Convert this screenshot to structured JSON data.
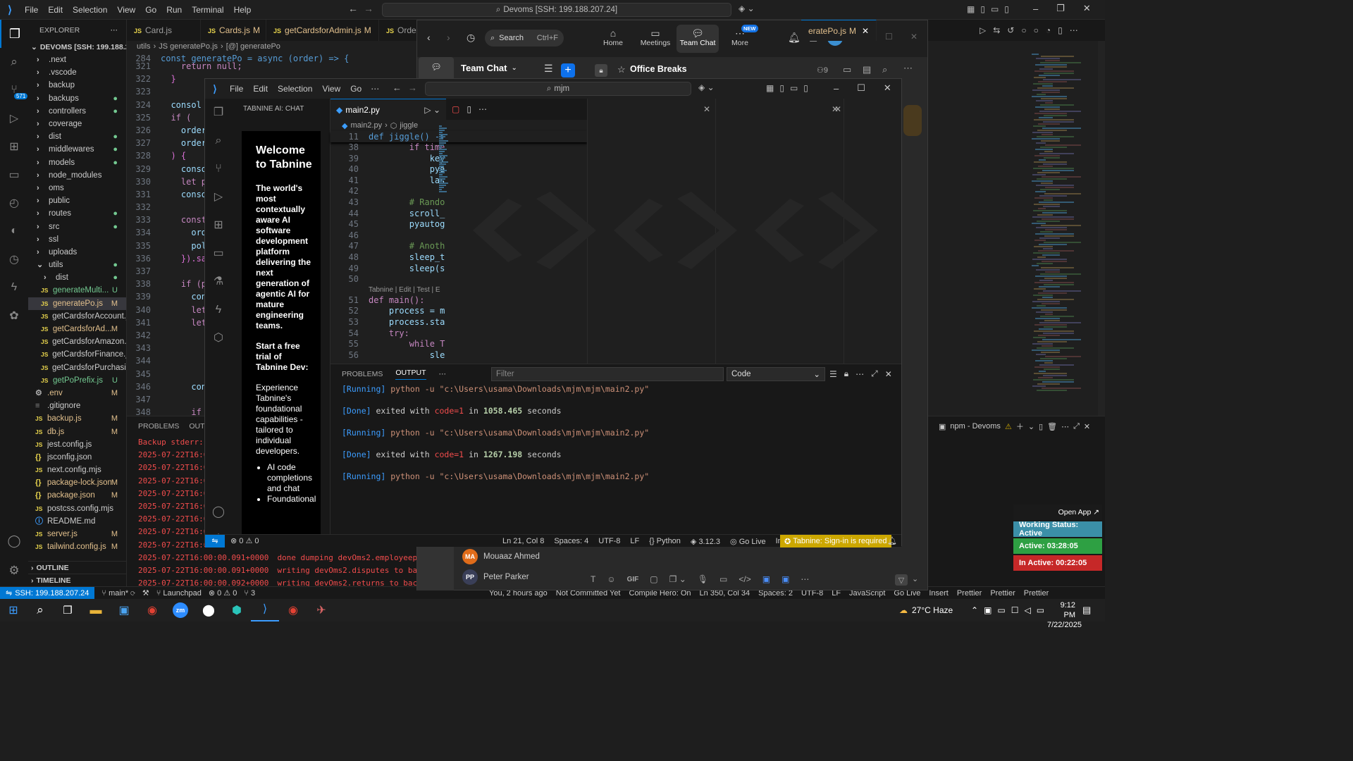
{
  "back_window": {
    "menu": [
      "File",
      "Edit",
      "Selection",
      "View",
      "Go",
      "Run",
      "Terminal",
      "Help"
    ],
    "search": "Devoms [SSH: 199.188.207.24]",
    "explorer_title": "EXPLORER",
    "root": "DEVOMS [SSH: 199.188.20...",
    "tree": [
      {
        "name": ".next",
        "type": "folder",
        "status": ""
      },
      {
        "name": ".vscode",
        "type": "folder",
        "status": ""
      },
      {
        "name": "backup",
        "type": "folder",
        "status": ""
      },
      {
        "name": "backups",
        "type": "folder",
        "status": "dot"
      },
      {
        "name": "controllers",
        "type": "folder",
        "status": "dot"
      },
      {
        "name": "coverage",
        "type": "folder",
        "status": ""
      },
      {
        "name": "dist",
        "type": "folder",
        "status": "dot"
      },
      {
        "name": "middlewares",
        "type": "folder",
        "status": "dot"
      },
      {
        "name": "models",
        "type": "folder",
        "status": "dot"
      },
      {
        "name": "node_modules",
        "type": "folder",
        "status": ""
      },
      {
        "name": "oms",
        "type": "folder",
        "status": ""
      },
      {
        "name": "public",
        "type": "folder",
        "status": ""
      },
      {
        "name": "routes",
        "type": "folder",
        "status": "dot"
      },
      {
        "name": "src",
        "type": "folder",
        "status": "dot"
      },
      {
        "name": "ssl",
        "type": "folder",
        "status": ""
      },
      {
        "name": "uploads",
        "type": "folder",
        "status": ""
      },
      {
        "name": "utils",
        "type": "folder-open",
        "status": "dot"
      },
      {
        "name": "dist",
        "type": "subfolder",
        "status": "dot"
      },
      {
        "name": "generateMulti...",
        "type": "js",
        "status": "U"
      },
      {
        "name": "generatePo.js",
        "type": "js",
        "status": "M"
      },
      {
        "name": "getCardsforAccount.js",
        "type": "js",
        "status": ""
      },
      {
        "name": "getCardsforAd...",
        "type": "js",
        "status": "M"
      },
      {
        "name": "getCardsforAmazon.js",
        "type": "js",
        "status": ""
      },
      {
        "name": "getCardsforFinance.js",
        "type": "js",
        "status": ""
      },
      {
        "name": "getCardsforPurchasi...",
        "type": "js",
        "status": ""
      },
      {
        "name": "getPoPrefix.js",
        "type": "js",
        "status": "U"
      },
      {
        "name": ".env",
        "type": "gear",
        "status": "M"
      },
      {
        "name": ".gitignore",
        "type": "plain",
        "status": ""
      },
      {
        "name": "backup.js",
        "type": "js",
        "status": "M"
      },
      {
        "name": "db.js",
        "type": "js",
        "status": "M"
      },
      {
        "name": "jest.config.js",
        "type": "js",
        "status": ""
      },
      {
        "name": "jsconfig.json",
        "type": "json",
        "status": ""
      },
      {
        "name": "next.config.mjs",
        "type": "js",
        "status": ""
      },
      {
        "name": "package-lock.json",
        "type": "json",
        "status": "M"
      },
      {
        "name": "package.json",
        "type": "json",
        "status": "M"
      },
      {
        "name": "postcss.config.mjs",
        "type": "js",
        "status": ""
      },
      {
        "name": "README.md",
        "type": "info",
        "status": ""
      },
      {
        "name": "server.js",
        "type": "js",
        "status": "M"
      },
      {
        "name": "tailwind.config.js",
        "type": "js",
        "status": "M"
      }
    ],
    "outline": "OUTLINE",
    "timeline": "TIMELINE",
    "tabs": [
      {
        "name": "Card.js",
        "status": ""
      },
      {
        "name": "Cards.js",
        "status": "M"
      },
      {
        "name": "getCardsforAdmin.js",
        "status": "M"
      },
      {
        "name": "Orders",
        "status": ""
      },
      {
        "name": "eratePo.js",
        "status": "M"
      }
    ],
    "breadcrumb": [
      "utils",
      "JS generatePo.js",
      "[@] generatePo"
    ],
    "sticky": {
      "num": "284",
      "text": "const generatePo = async (order) => {"
    },
    "code": [
      {
        "n": "321",
        "t": "    return null;"
      },
      {
        "n": "322",
        "t": "  }"
      },
      {
        "n": "323",
        "t": ""
      },
      {
        "n": "324",
        "t": "  consol"
      },
      {
        "n": "325",
        "t": "  if ("
      },
      {
        "n": "326",
        "t": "    order"
      },
      {
        "n": "327",
        "t": "    order"
      },
      {
        "n": "328",
        "t": "  ) {"
      },
      {
        "n": "329",
        "t": "    conso"
      },
      {
        "n": "330",
        "t": "    let p"
      },
      {
        "n": "331",
        "t": "    conso"
      },
      {
        "n": "332",
        "t": ""
      },
      {
        "n": "333",
        "t": "    const"
      },
      {
        "n": "334",
        "t": "      ord"
      },
      {
        "n": "335",
        "t": "      pol"
      },
      {
        "n": "336",
        "t": "    }).sa"
      },
      {
        "n": "337",
        "t": ""
      },
      {
        "n": "338",
        "t": "    if (p"
      },
      {
        "n": "339",
        "t": "      con"
      },
      {
        "n": "340",
        "t": "      let"
      },
      {
        "n": "341",
        "t": "      let"
      },
      {
        "n": "342",
        "t": "        "
      },
      {
        "n": "343",
        "t": "        "
      },
      {
        "n": "344",
        "t": "        "
      },
      {
        "n": "345",
        "t": ""
      },
      {
        "n": "346",
        "t": "      con"
      },
      {
        "n": "347",
        "t": ""
      },
      {
        "n": "348",
        "t": "      if"
      },
      {
        "n": "349",
        "t": "        "
      },
      {
        "n": "350",
        "t": "        "
      },
      {
        "n": "351",
        "t": ""
      }
    ],
    "panel_tabs": [
      "PROBLEMS",
      "OUTPU"
    ],
    "terminal_title": "npm - Devoms",
    "logs_left": [
      "Backup stderr: 20",
      "2025-07-22T16:00",
      "2025-07-22T16:00",
      "2025-07-22T16:00",
      "2025-07-22T16:00",
      "2025-07-22T16:00",
      "2025-07-22T16:00",
      "2025-07-22T16:00",
      "2025-07-22T16:00"
    ],
    "logs_full": [
      {
        "ts": "2025-07-22T16:00:00.091+0000",
        "msg": "done dumping devOms2.employeeperforma"
      },
      {
        "ts": "2025-07-22T16:00:00.091+0000",
        "msg": "writing devOms2.disputes to backup/de"
      },
      {
        "ts": "2025-07-22T16:00:00.092+0000",
        "msg": "writing devOms2.returns to backup/dev"
      },
      {
        "ts": "2025-07-22T16:00:00.093+0000",
        "msg": "done dumping devOms2.disputes (3 docu"
      }
    ],
    "status_left": {
      "ssh": "SSH: 199.188.207.24",
      "branch": "main*",
      "errors": "0",
      "warnings": "0",
      "launchpad": "Launchpad",
      "ports": "3"
    },
    "status_right": [
      "You, 2 hours ago",
      "Not Committed Yet",
      "Compile Hero: On",
      "Ln 350, Col 34",
      "Spaces: 2",
      "UTF-8",
      "LF",
      "JavaScript",
      "Go Live",
      "Insert",
      "Prettier",
      "Prettier",
      "Prettier"
    ]
  },
  "teams": {
    "search": "Search",
    "shortcut": "Ctrl+F",
    "nav": [
      {
        "label": "Home"
      },
      {
        "label": "Meetings"
      },
      {
        "label": "Team Chat"
      },
      {
        "label": "More",
        "badge": "NEW"
      }
    ],
    "avatar": "UR",
    "section": "Team Chat",
    "channel": "Office Breaks",
    "members": "9",
    "people": [
      {
        "initials": "MA",
        "name": "Mouaaz Ahmed",
        "color": "#e06c1a"
      },
      {
        "initials": "PP",
        "name": "Peter Parker",
        "color": "#3a3f58"
      }
    ],
    "compose_gif": "GIF"
  },
  "front_window": {
    "menu": [
      "File",
      "Edit",
      "Selection",
      "View",
      "Go"
    ],
    "search": "mjm",
    "chat_panel_title": "TABNINE AI: CHAT",
    "welcome_title": "Welcome to Tabnine",
    "welcome_body": "The world's most contextually aware AI software development platform delivering the next generation of agentic AI for mature engineering teams.",
    "trial_title": "Start a free trial of Tabnine Dev:",
    "trial_body": "Experience Tabnine's foundational capabilities - tailored to individual developers.",
    "bullets": [
      "AI code completions and chat",
      "Foundational"
    ],
    "tab": "main2.py",
    "breadcrumb": [
      "main2.py",
      "jiggle"
    ],
    "sticky": {
      "n": "11",
      "t": "def jiggle() ->"
    },
    "code": [
      {
        "n": "38",
        "t": "        if time"
      },
      {
        "n": "39",
        "t": "            key"
      },
      {
        "n": "40",
        "t": "            pya"
      },
      {
        "n": "41",
        "t": "            las"
      },
      {
        "n": "42",
        "t": ""
      },
      {
        "n": "43",
        "t": "        # Rando"
      },
      {
        "n": "44",
        "t": "        scroll_"
      },
      {
        "n": "45",
        "t": "        pyautog"
      },
      {
        "n": "46",
        "t": ""
      },
      {
        "n": "47",
        "t": "        # Anoth"
      },
      {
        "n": "48",
        "t": "        sleep_t"
      },
      {
        "n": "49",
        "t": "        sleep(s"
      },
      {
        "n": "50",
        "t": ""
      },
      {
        "n": "lens",
        "t": "Tabnine | Edit | Test | E"
      },
      {
        "n": "51",
        "t": "def main():"
      },
      {
        "n": "52",
        "t": "    process = m"
      },
      {
        "n": "53",
        "t": "    process.sta"
      },
      {
        "n": "54",
        "t": "    try:"
      },
      {
        "n": "55",
        "t": "        while T"
      },
      {
        "n": "56",
        "t": "            sle"
      }
    ],
    "panel_tabs": [
      "PROBLEMS",
      "OUTPUT"
    ],
    "filter_placeholder": "Filter",
    "output_channel": "Code",
    "output": [
      {
        "kind": "running",
        "label": "[Running]",
        "text": " python -u \"c:\\Users\\usama\\Downloads\\mjm\\mjm\\main2.py\""
      },
      {
        "kind": "done",
        "label": "[Done]",
        "text": " exited with ",
        "code": "code=1",
        "in": " in ",
        "secs": "1058.465",
        "unit": " seconds"
      },
      {
        "kind": "running",
        "label": "[Running]",
        "text": " python -u \"c:\\Users\\usama\\Downloads\\mjm\\mjm\\main2.py\""
      },
      {
        "kind": "done",
        "label": "[Done]",
        "text": " exited with ",
        "code": "code=1",
        "in": " in ",
        "secs": "1267.198",
        "unit": " seconds"
      },
      {
        "kind": "running",
        "label": "[Running]",
        "text": " python -u \"c:\\Users\\usama\\Downloads\\mjm\\mjm\\main2.py\""
      }
    ],
    "status": {
      "errors": "0",
      "warnings": "0",
      "pos": "Ln 21, Col 8",
      "spaces": "Spaces: 4",
      "enc": "UTF-8",
      "eol": "LF",
      "lang": "Python",
      "ver": "3.12.3",
      "golive": "Go Live",
      "insert": "Insert",
      "tabnine": "Tabnine: Sign-in is required"
    }
  },
  "tracker": {
    "open_app": "Open App ↗",
    "working": "Working Status: Active",
    "active": "Active: 03:28:05",
    "inactive": "In Active: 00:22:05"
  },
  "taskbar": {
    "weather": "27°C  Haze",
    "time": "9:12 PM",
    "date": "7/22/2025"
  },
  "colors": {
    "accent": "#0078d4",
    "teams_blue": "#0e71eb",
    "green": "#2ea043",
    "red": "#c62828",
    "yellow": "#cca700"
  }
}
